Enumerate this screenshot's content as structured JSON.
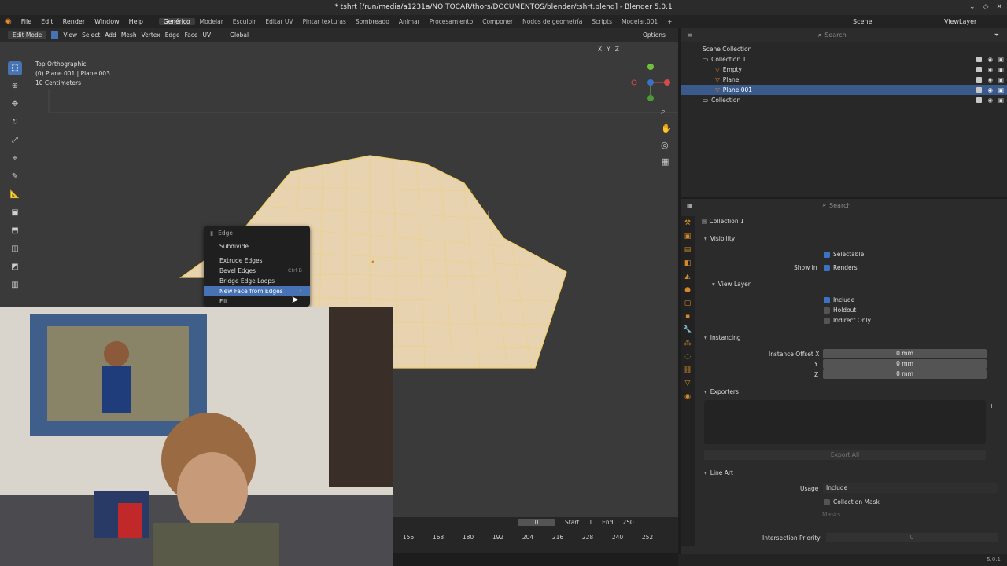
{
  "window": {
    "title": "* tshrt [/run/media/a1231a/NO TOCAR/thors/DOCUMENTOS/blender/tshrt.blend] - Blender 5.0.1"
  },
  "menubar": {
    "items": [
      "File",
      "Edit",
      "Render",
      "Window",
      "Help"
    ],
    "workspaces": [
      "Genérico",
      "Modelar",
      "Esculpir",
      "Editar UV",
      "Pintar texturas",
      "Sombreado",
      "Animar",
      "Procesamiento",
      "Componer",
      "Nodos de geometría",
      "Scripts",
      "Modelar.001"
    ],
    "active_workspace": "Genérico",
    "add_tab": "+",
    "scene": "Scene",
    "view_layer": "ViewLayer"
  },
  "viewport_header": {
    "mode": "Edit Mode",
    "items": [
      "View",
      "Select",
      "Add",
      "Mesh",
      "Vertex",
      "Edge",
      "Face",
      "UV"
    ],
    "orientation": "Global",
    "options": "Options",
    "axes": [
      "X",
      "Y",
      "Z"
    ]
  },
  "overlay": {
    "view": "Top Orthographic",
    "objects": "(0) Plane.001 | Plane.003",
    "scale": "10 Centimeters"
  },
  "context_menu": {
    "title": "Edge",
    "items": [
      {
        "label": "Subdivide",
        "shortcut": ""
      },
      {
        "label": "Extrude Edges",
        "shortcut": ""
      },
      {
        "label": "Bevel Edges",
        "shortcut": "Ctrl B"
      },
      {
        "label": "Bridge Edge Loops",
        "shortcut": ""
      },
      {
        "label": "New Face from Edges",
        "shortcut": "F"
      },
      {
        "label": "Fill",
        "shortcut": ""
      }
    ]
  },
  "timeline": {
    "frame": "0",
    "start_label": "Start",
    "start": "1",
    "end_label": "End",
    "end": "250",
    "ticks": [
      "156",
      "168",
      "180",
      "192",
      "204",
      "216",
      "228",
      "240",
      "252"
    ]
  },
  "outliner": {
    "search_placeholder": "Search",
    "root": "Scene Collection",
    "rows": [
      {
        "label": "Collection 1",
        "indent": 1
      },
      {
        "label": "Empty",
        "indent": 2
      },
      {
        "label": "Plane",
        "indent": 2
      },
      {
        "label": "Plane.001",
        "indent": 2,
        "selected": true
      },
      {
        "label": "Collection",
        "indent": 1
      }
    ]
  },
  "properties": {
    "search_placeholder": "Search",
    "context": "Collection 1",
    "visibility": {
      "title": "Visibility",
      "selectable": "Selectable",
      "show_in": "Show In",
      "renders": "Renders"
    },
    "view_layer": {
      "title": "View Layer",
      "include": "Include",
      "holdout": "Holdout",
      "indirect_only": "Indirect Only"
    },
    "instancing": {
      "title": "Instancing",
      "offset_x_label": "Instance Offset X",
      "y_label": "Y",
      "z_label": "Z",
      "x": "0 mm",
      "y": "0 mm",
      "z": "0 mm"
    },
    "exporters": {
      "title": "Exporters",
      "export_all": "Export All"
    },
    "line_art": {
      "title": "Line Art",
      "usage_label": "Usage",
      "usage": "Include",
      "collection_mask": "Collection Mask",
      "masks": "Masks",
      "intersection_priority": "Intersection Priority",
      "intersection_value": "0"
    }
  },
  "status": {
    "version": "5.0.1"
  },
  "colors": {
    "accent": "#4772b3",
    "mesh": "#e8d3b0",
    "wire": "#f0d060"
  }
}
